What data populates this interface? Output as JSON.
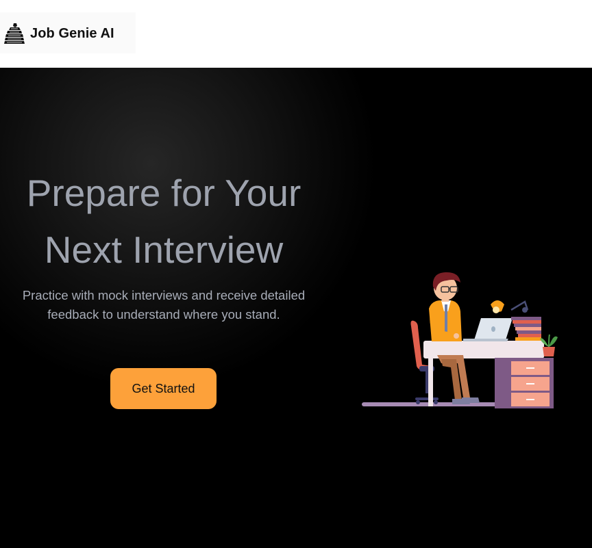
{
  "header": {
    "brand_name": "Job Genie AI",
    "logo_icon": "genie-logo-icon"
  },
  "hero": {
    "title_line1": "Prepare for Your",
    "title_line2": "Next Interview",
    "subtitle": "Practice with mock interviews and receive detailed feedback to understand where you stand.",
    "cta_label": "Get Started",
    "illustration": "person-at-desk-illustration"
  },
  "colors": {
    "accent": "#fda13a",
    "hero_text": "#9ea3ae",
    "background": "#000000",
    "header_bg": "#ffffff"
  }
}
